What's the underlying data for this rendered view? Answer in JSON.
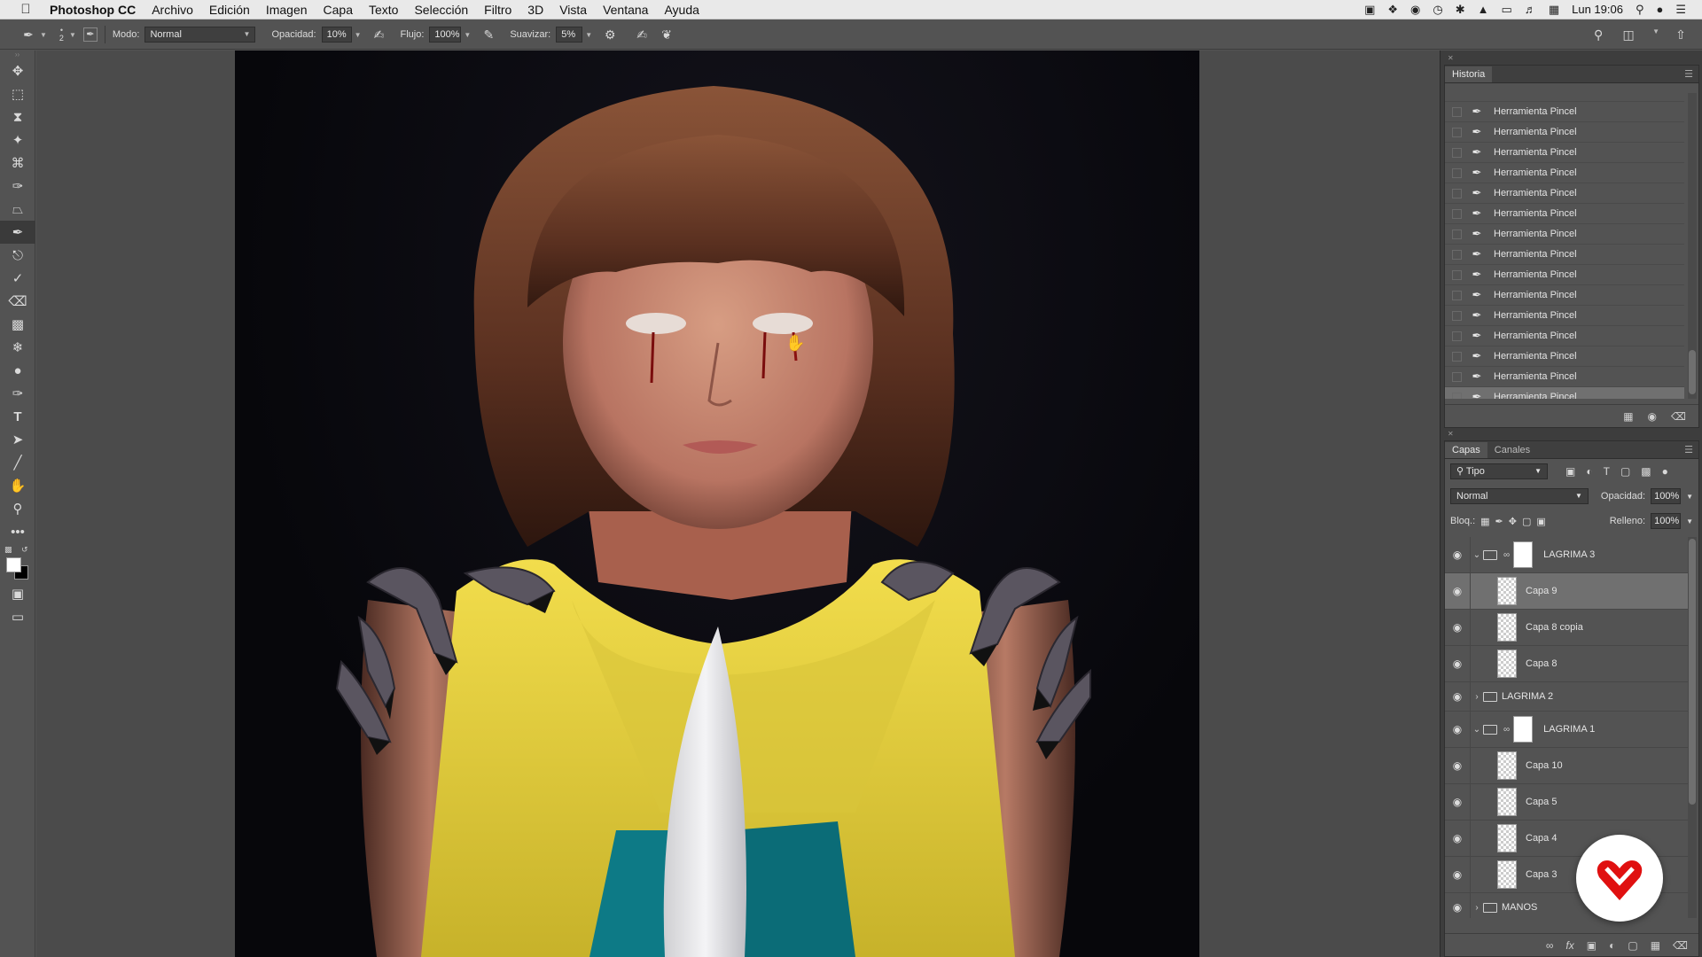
{
  "menubar": {
    "app_name": "Photoshop CC",
    "items": [
      "Archivo",
      "Edición",
      "Imagen",
      "Capa",
      "Texto",
      "Selección",
      "Filtro",
      "3D",
      "Vista",
      "Ventana",
      "Ayuda"
    ],
    "clock": "Lun 19:06"
  },
  "options": {
    "brush_size": "2",
    "mode_label": "Modo:",
    "mode_value": "Normal",
    "opacity_label": "Opacidad:",
    "opacity_value": "10%",
    "flow_label": "Flujo:",
    "flow_value": "100%",
    "smooth_label": "Suavizar:",
    "smooth_value": "5%"
  },
  "history": {
    "tab": "Historia",
    "items": [
      "Herramienta Pincel",
      "Herramienta Pincel",
      "Herramienta Pincel",
      "Herramienta Pincel",
      "Herramienta Pincel",
      "Herramienta Pincel",
      "Herramienta Pincel",
      "Herramienta Pincel",
      "Herramienta Pincel",
      "Herramienta Pincel",
      "Herramienta Pincel",
      "Herramienta Pincel",
      "Herramienta Pincel",
      "Herramienta Pincel",
      "Herramienta Pincel"
    ]
  },
  "layers": {
    "tabs": [
      "Capas",
      "Canales"
    ],
    "filter_value": "Tipo",
    "blend_mode": "Normal",
    "opacity_label": "Opacidad:",
    "opacity_value": "100%",
    "lock_label": "Bloq.:",
    "fill_label": "Relleno:",
    "fill_value": "100%",
    "rows": [
      {
        "name": "LAGRIMA 3"
      },
      {
        "name": "Capa 9"
      },
      {
        "name": "Capa 8 copia"
      },
      {
        "name": "Capa 8"
      },
      {
        "name": "LAGRIMA 2"
      },
      {
        "name": "LAGRIMA 1"
      },
      {
        "name": "Capa 10"
      },
      {
        "name": "Capa 5"
      },
      {
        "name": "Capa 4"
      },
      {
        "name": "Capa 3"
      },
      {
        "name": "MANOS"
      }
    ]
  },
  "colors": {
    "foreground": "#ffffff",
    "background": "#000000",
    "badge_red": "#e01010"
  }
}
